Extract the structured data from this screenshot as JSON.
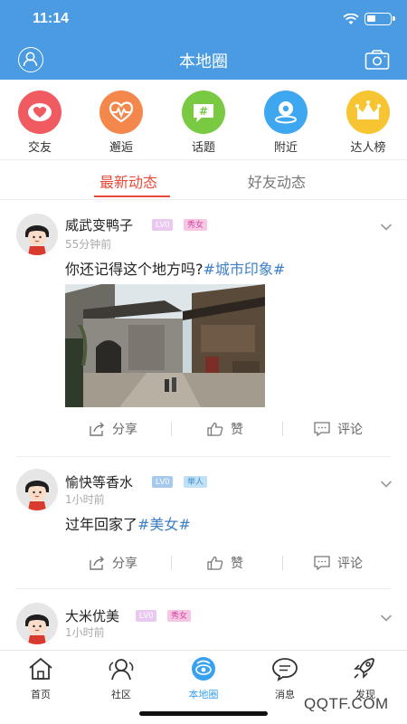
{
  "status_bar": {
    "time": "11:14"
  },
  "header": {
    "title": "本地圈"
  },
  "quick_nav": [
    {
      "label": "交友",
      "icon": "heart-icon",
      "color": "#f05a61"
    },
    {
      "label": "邂逅",
      "icon": "heartbeat-icon",
      "color": "#f4874b"
    },
    {
      "label": "话题",
      "icon": "hashtag-icon",
      "color": "#7ac943"
    },
    {
      "label": "附近",
      "icon": "location-icon",
      "color": "#3fa7f0"
    },
    {
      "label": "达人榜",
      "icon": "crown-icon",
      "color": "#f7c531"
    }
  ],
  "tabs": [
    {
      "label": "最新动态",
      "active": true
    },
    {
      "label": "好友动态",
      "active": false
    }
  ],
  "posts": [
    {
      "user": "威武变鸭子",
      "level": "LV0",
      "tag": "秀女",
      "time": "55分钟前",
      "text": "你还记得这个地方吗?",
      "topic": "#城市印象#",
      "has_photo": true
    },
    {
      "user": "愉快等香水",
      "level": "LV0",
      "tag": "举人",
      "time": "1小时前",
      "text": "过年回家了",
      "topic": "#美女#",
      "has_photo": false
    },
    {
      "user": "大米优美",
      "level": "LV0",
      "tag": "秀女",
      "time": "1小时前"
    }
  ],
  "actions": {
    "share": "分享",
    "like": "赞",
    "comment": "评论"
  },
  "bottom_nav": [
    {
      "label": "首页",
      "icon": "home-icon",
      "active": false
    },
    {
      "label": "社区",
      "icon": "community-icon",
      "active": false
    },
    {
      "label": "本地圈",
      "icon": "local-circle-icon",
      "active": true
    },
    {
      "label": "消息",
      "icon": "message-icon",
      "active": false
    },
    {
      "label": "发现",
      "icon": "rocket-icon",
      "active": false
    }
  ],
  "watermark": "QQTF.COM",
  "colors": {
    "header": "#4a9be2",
    "accent_red": "#e84a3a",
    "topic_blue": "#3d7fc6",
    "active_tab_blue": "#39a2f0"
  }
}
